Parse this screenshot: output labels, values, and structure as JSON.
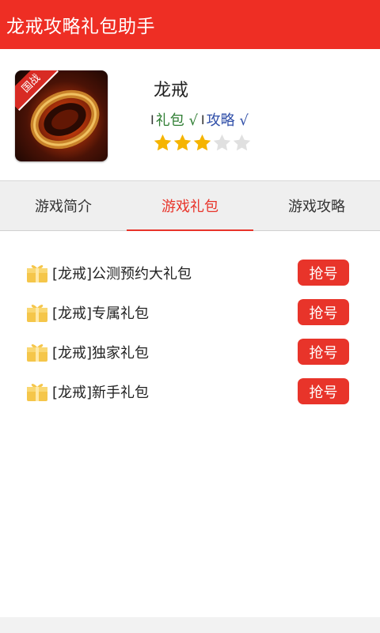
{
  "header": {
    "title": "龙戒攻略礼包助手"
  },
  "game": {
    "icon_badge": "国战",
    "name": "龙戒",
    "tag_separator": "I",
    "tag_gift": "礼包 √",
    "tag_separator2": "I",
    "tag_guide": "攻略 √",
    "rating": {
      "filled": 3,
      "total": 5
    }
  },
  "colors": {
    "brand": "#ee2e24",
    "accent": "#e8342a",
    "star_on": "#f5b400",
    "star_off": "#e0e0e0"
  },
  "tabs": [
    {
      "label": "游戏简介"
    },
    {
      "label": "游戏礼包",
      "active": true
    },
    {
      "label": "游戏攻略"
    }
  ],
  "gifts": [
    {
      "label": "[龙戒]公测预约大礼包",
      "button": "抢号"
    },
    {
      "label": "[龙戒]专属礼包",
      "button": "抢号"
    },
    {
      "label": "[龙戒]独家礼包",
      "button": "抢号"
    },
    {
      "label": "[龙戒]新手礼包",
      "button": "抢号"
    }
  ]
}
